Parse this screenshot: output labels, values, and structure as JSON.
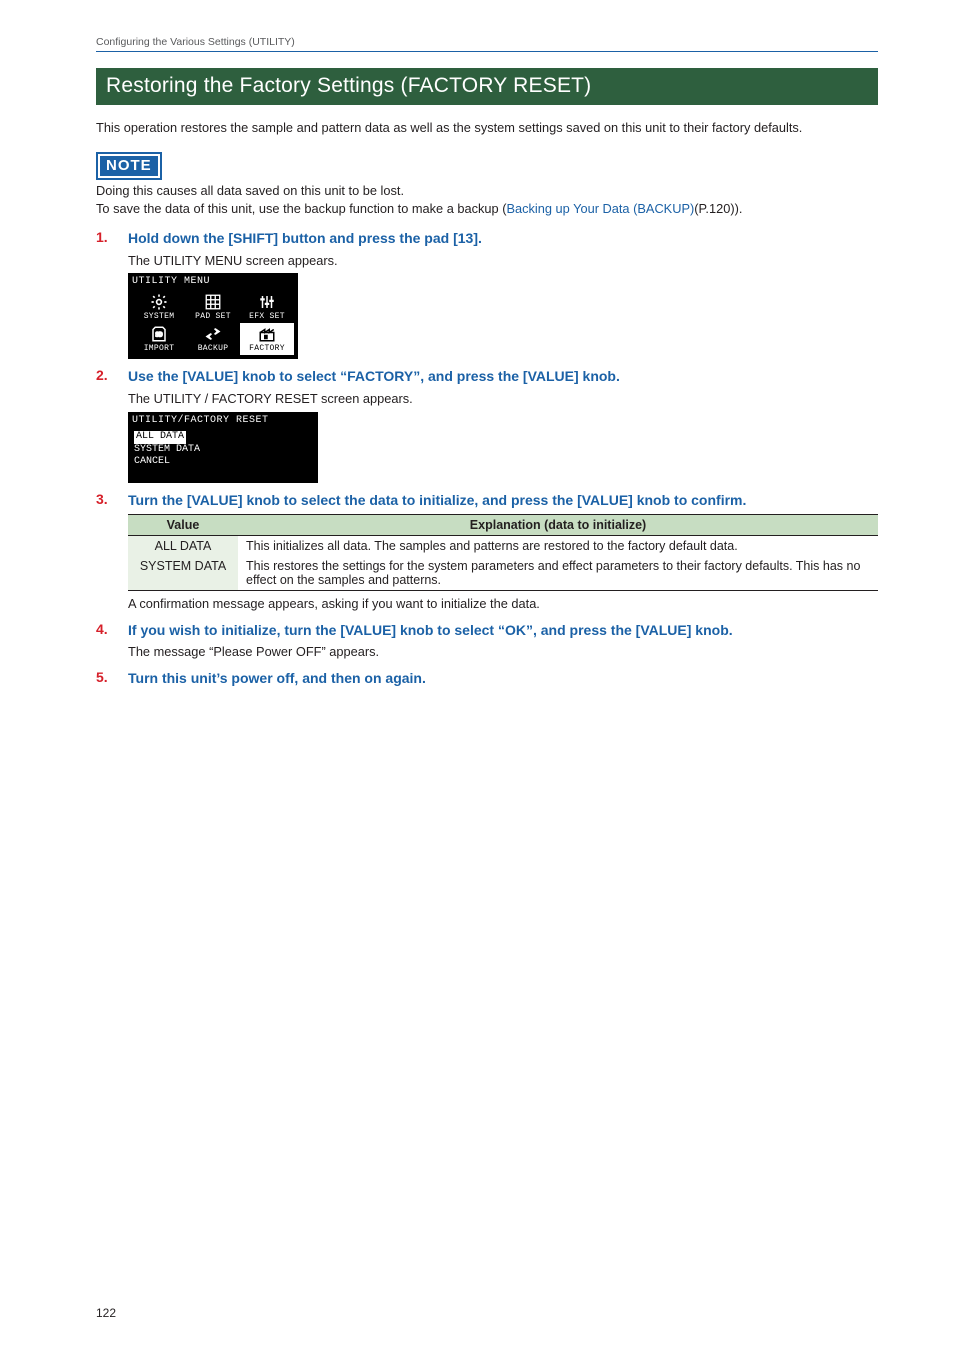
{
  "runningHead": "Configuring the Various Settings (UTILITY)",
  "h1": "Restoring the Factory Settings (FACTORY RESET)",
  "intro": "This operation restores the sample and pattern data as well as the system settings saved on this unit to their factory defaults.",
  "noteBadge": "NOTE",
  "noteLines": {
    "l1": "Doing this causes all data saved on this unit to be lost.",
    "l2a": "To save the data of this unit, use the backup function to make a backup (",
    "l2link": "Backing up Your Data (BACKUP)",
    "l2b": "(P.120))."
  },
  "steps": {
    "s1": {
      "num": "1.",
      "head": "Hold down the [SHIFT] button and press the pad [13].",
      "desc": "The UTILITY MENU screen appears."
    },
    "s2": {
      "num": "2.",
      "head": "Use the [VALUE] knob to select “FACTORY”, and press the [VALUE] knob.",
      "desc": "The UTILITY / FACTORY RESET screen appears."
    },
    "s3": {
      "num": "3.",
      "head": "Turn the [VALUE] knob to select the data to initialize, and press the [VALUE] knob to confirm.",
      "tableNote": "A confirmation message appears, asking if you want to initialize the data."
    },
    "s4": {
      "num": "4.",
      "head": "If you wish to initialize, turn the [VALUE] knob to select “OK”, and press the [VALUE] knob.",
      "desc": "The message “Please Power OFF” appears."
    },
    "s5": {
      "num": "5.",
      "head": "Turn this unit’s power off, and then on again."
    }
  },
  "lcd1": {
    "title": "UTILITY MENU",
    "items": [
      {
        "label": "SYSTEM",
        "icon": "gear",
        "sel": false
      },
      {
        "label": "PAD SET",
        "icon": "grid",
        "sel": false
      },
      {
        "label": "EFX SET",
        "icon": "sliders",
        "sel": false
      },
      {
        "label": "IMPORT",
        "icon": "sd",
        "sel": false
      },
      {
        "label": "BACKUP",
        "icon": "swap",
        "sel": false
      },
      {
        "label": "FACTORY",
        "icon": "factory",
        "sel": true
      }
    ]
  },
  "lcd2": {
    "title": "UTILITY/FACTORY RESET",
    "items": [
      {
        "label": "ALL DATA",
        "sel": true
      },
      {
        "label": "SYSTEM DATA",
        "sel": false
      },
      {
        "label": "CANCEL",
        "sel": false
      }
    ]
  },
  "table": {
    "headers": {
      "value": "Value",
      "expl": "Explanation (data to initialize)"
    },
    "rows": [
      {
        "value": "ALL DATA",
        "expl": "This initializes all data. The samples and patterns are restored to the factory default data."
      },
      {
        "value": "SYSTEM DATA",
        "expl": "This restores the settings for the system parameters and effect parameters to their factory defaults. This has no effect on the samples and patterns."
      }
    ]
  },
  "pageNum": "122"
}
